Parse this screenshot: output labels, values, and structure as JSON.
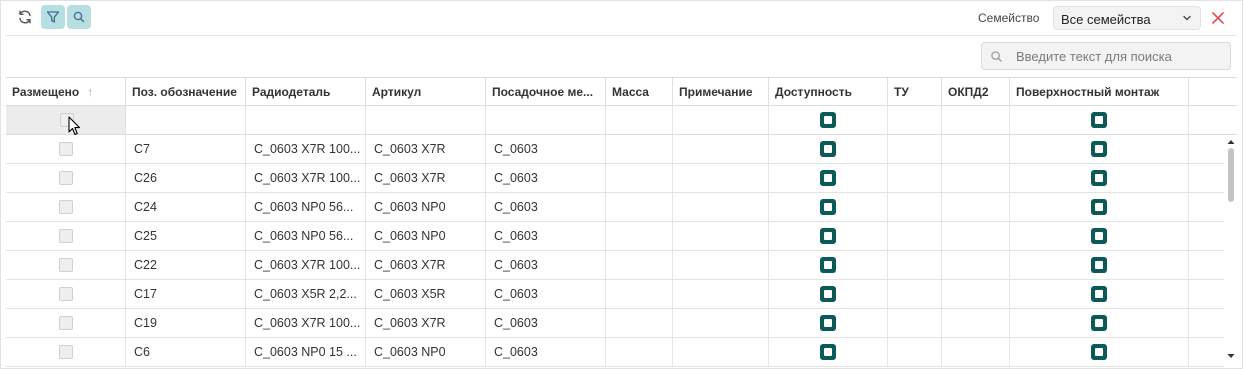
{
  "toolbar": {
    "refresh_icon": "refresh-icon",
    "filter_icon": "filter-icon",
    "search_icon": "search-icon"
  },
  "family": {
    "label": "Семейство",
    "selected": "Все семейства"
  },
  "search": {
    "placeholder": "Введите текст для поиска",
    "value": ""
  },
  "colors": {
    "accent": "#b7dfe2",
    "check": "#0c5a57",
    "close": "#e05050"
  },
  "table": {
    "columns": [
      "Размещено",
      "Поз. обозначение",
      "Радиодеталь",
      "Артикул",
      "Посадочное ме...",
      "Масса",
      "Примечание",
      "Доступность",
      "ТУ",
      "ОКПД2",
      "Поверхностный монтаж"
    ],
    "sort_indicator": "↑",
    "rows": [
      {
        "pos": "C7",
        "part": "C_0603 X7R 100...",
        "article": "C_0603 X7R",
        "footprint": "C_0603"
      },
      {
        "pos": "C26",
        "part": "C_0603 X7R 100...",
        "article": "C_0603 X7R",
        "footprint": "C_0603"
      },
      {
        "pos": "C24",
        "part": "C_0603 NP0 56...",
        "article": "C_0603 NP0",
        "footprint": "C_0603"
      },
      {
        "pos": "C25",
        "part": "C_0603 NP0 56...",
        "article": "C_0603 NP0",
        "footprint": "C_0603"
      },
      {
        "pos": "C22",
        "part": "C_0603 X7R 100...",
        "article": "C_0603 X7R",
        "footprint": "C_0603"
      },
      {
        "pos": "C17",
        "part": "C_0603 X5R 2,2...",
        "article": "C_0603 X5R",
        "footprint": "C_0603"
      },
      {
        "pos": "C19",
        "part": "C_0603 X7R 100...",
        "article": "C_0603 X7R",
        "footprint": "C_0603"
      },
      {
        "pos": "C6",
        "part": "C_0603 NP0 15 ...",
        "article": "C_0603 NP0",
        "footprint": "C_0603"
      }
    ]
  }
}
